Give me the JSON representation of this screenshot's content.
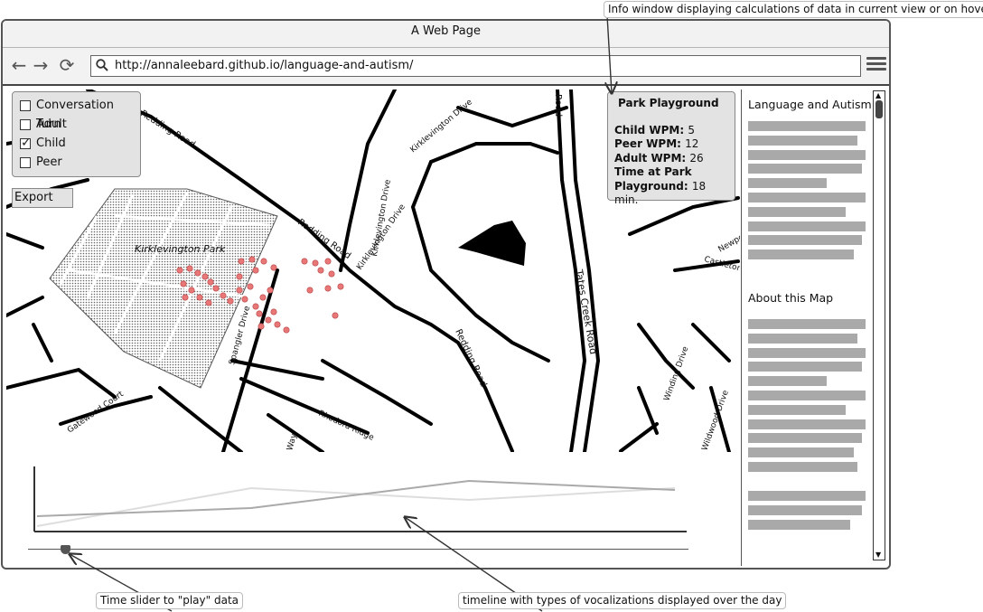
{
  "window": {
    "title": "A Web Page",
    "url": "http://annaleebard.github.io/language-and-autism/"
  },
  "nav": {
    "back": "←",
    "forward": "→",
    "reload": "⟳"
  },
  "layers": [
    {
      "label": "Conversation Turn",
      "checked": false
    },
    {
      "label": "Adult",
      "checked": false
    },
    {
      "label": "Child",
      "checked": true
    },
    {
      "label": "Peer",
      "checked": false
    }
  ],
  "export_label": "Export",
  "map": {
    "labels": {
      "redding_road_1": "Redding Road",
      "redding_road_2": "Redding Road",
      "redding_road_3": "Redding Road",
      "redding_road_4": "Redding Road",
      "kirklevington_drive_1": "Kirklevington Drive",
      "kirklevington_drive_2": "Kirklevington Drive",
      "kirklevington_drive_3": "Kirklevington Drive",
      "park": "Kirklevington Park",
      "tates_creek": "Tates Creek Road",
      "road": "Road",
      "spangler": "Spangler Drive",
      "gatewood": "Gatewood Court",
      "rhodora": "Rhodora Ridge",
      "way": "Way",
      "winding": "Winding Drive",
      "wildwood": "Wildwood Drive",
      "newport": "Newport",
      "castleton": "Castleton"
    },
    "point_color": "#e87878"
  },
  "info": {
    "title": "Park Playground",
    "rows": [
      {
        "label": "Child WPM:",
        "value": "5"
      },
      {
        "label": "Peer WPM:",
        "value": "12"
      },
      {
        "label": "Adult WPM:",
        "value": "26"
      },
      {
        "label": "Time at Park",
        "value": ""
      },
      {
        "label": "Playground:",
        "value": "18 min."
      }
    ]
  },
  "sidebar": {
    "heading1": "Language and Autism",
    "heading2": "About this Map"
  },
  "annotations": {
    "info": "Info window displaying calculations of data in current view or on hover",
    "slider": "Time slider to \"play\" data",
    "timeline": "timeline with types of vocalizations displayed over the day"
  }
}
